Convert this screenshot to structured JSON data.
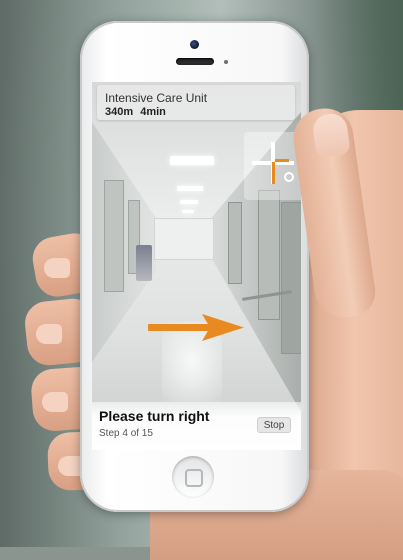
{
  "navigation": {
    "destination": "Intensive Care Unit",
    "distance": "340m",
    "duration": "4min",
    "instruction": "Please turn right",
    "step": "Step 4 of 15",
    "stop_label": "Stop",
    "arrow_direction": "right"
  },
  "colors": {
    "accent": "#e98a21",
    "banner_bg": "#e8e8e8",
    "panel_bg": "#ffffff"
  },
  "icons": {
    "direction_arrow": "arrow-right-icon",
    "compass": "crosshair-compass-icon",
    "home_button": "home-button-icon"
  }
}
